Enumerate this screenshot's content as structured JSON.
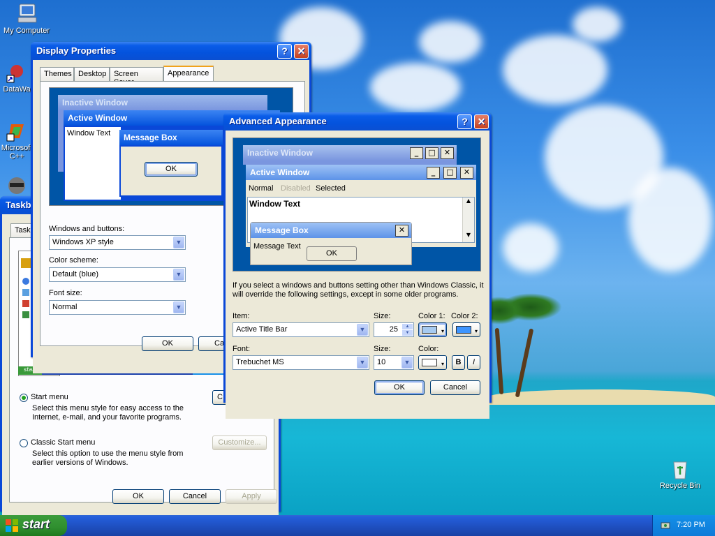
{
  "desktop": {
    "icons": [
      {
        "label": "My Computer"
      },
      {
        "label": "DataWa"
      },
      {
        "label": "Microsoft C++"
      },
      {
        "label": "Recycle Bin"
      }
    ]
  },
  "taskbar": {
    "start_label": "start",
    "clock": "7:20 PM"
  },
  "taskbar_props": {
    "title": "Taskba",
    "tab": "Taskb",
    "start_menu_option": "Start menu",
    "start_menu_desc": "Select this menu style for easy access to the Internet, e-mail, and your favorite programs.",
    "customize_cut": "C",
    "classic_option": "Classic Start menu",
    "classic_desc": "Select this option to use the menu style from earlier versions of Windows.",
    "customize_label": "Customize...",
    "ok_label": "OK",
    "cancel_label": "Cancel",
    "apply_label": "Apply",
    "preview_start": "start"
  },
  "display_props": {
    "title": "Display Properties",
    "tabs": [
      "Themes",
      "Desktop",
      "Screen Saver",
      "Appearance"
    ],
    "selected_tab": "Appearance",
    "preview": {
      "inactive_title": "Inactive Window",
      "active_title": "Active Window",
      "window_text": "Window Text",
      "message_box_title": "Message Box",
      "message_box_ok": "OK"
    },
    "windows_buttons_label": "Windows and buttons:",
    "windows_buttons_value": "Windows XP style",
    "color_scheme_label": "Color scheme:",
    "color_scheme_value": "Default (blue)",
    "font_size_label": "Font size:",
    "font_size_value": "Normal",
    "ok_label": "OK",
    "cancel_cut": "Ca"
  },
  "advanced": {
    "title": "Advanced Appearance",
    "preview": {
      "inactive_title": "Inactive Window",
      "active_title": "Active Window",
      "menu_normal": "Normal",
      "menu_disabled": "Disabled",
      "menu_selected": "Selected",
      "window_text": "Window Text",
      "message_box_title": "Message Box",
      "message_text": "Message Text",
      "ok": "OK"
    },
    "info_text": "If you select a windows and buttons setting other than Windows Classic, it will override the following settings, except in some older programs.",
    "item_label": "Item:",
    "item_value": "Active Title Bar",
    "size_label": "Size:",
    "size_value": "25",
    "color1_label": "Color 1:",
    "color2_label": "Color 2:",
    "color1": "#a6caf0",
    "color2": "#3d95ff",
    "font_label": "Font:",
    "font_value": "Trebuchet MS",
    "font_size_label": "Size:",
    "font_size_value": "10",
    "font_color_label": "Color:",
    "font_color": "#ffffff",
    "bold_label": "B",
    "italic_label": "I",
    "ok_label": "OK",
    "cancel_label": "Cancel"
  }
}
